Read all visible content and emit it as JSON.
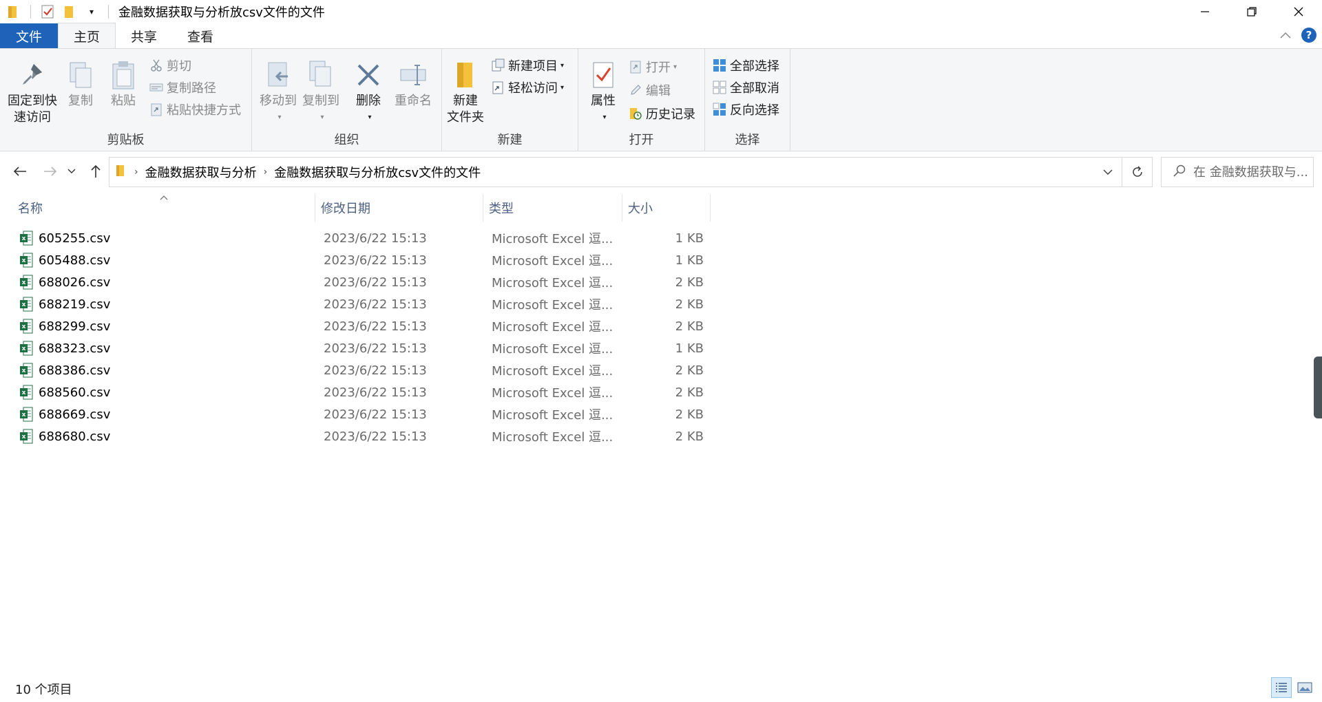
{
  "window": {
    "title": "金融数据获取与分析放csv文件的文件",
    "controls": {
      "minimize": "—",
      "restore": "❐",
      "close": "✕"
    }
  },
  "ribbon": {
    "tabs": {
      "file": "文件",
      "home": "主页",
      "share": "共享",
      "view": "查看"
    },
    "clipboard": {
      "label": "剪贴板",
      "pin": [
        "固定到快",
        "速访问"
      ],
      "copy": "复制",
      "paste": "粘贴",
      "cut": "剪切",
      "copy_path": "复制路径",
      "paste_shortcut": "粘贴快捷方式"
    },
    "organize": {
      "label": "组织",
      "move_to": "移动到",
      "copy_to": "复制到",
      "delete": "删除",
      "rename": "重命名"
    },
    "new": {
      "label": "新建",
      "new_folder": [
        "新建",
        "文件夹"
      ],
      "new_item": "新建项目",
      "easy_access": "轻松访问"
    },
    "open": {
      "label": "打开",
      "properties": "属性",
      "open": "打开",
      "edit": "编辑",
      "history": "历史记录"
    },
    "select": {
      "label": "选择",
      "select_all": "全部选择",
      "select_none": "全部取消",
      "invert": "反向选择"
    }
  },
  "address": {
    "crumbs": [
      "金融数据获取与分析",
      "金融数据获取与分析放csv文件的文件"
    ],
    "search_placeholder": "在 金融数据获取与..."
  },
  "columns": {
    "name": "名称",
    "date": "修改日期",
    "type": "类型",
    "size": "大小"
  },
  "files": [
    {
      "name": "605255.csv",
      "date": "2023/6/22 15:13",
      "type": "Microsoft Excel 逗...",
      "size": "1 KB"
    },
    {
      "name": "605488.csv",
      "date": "2023/6/22 15:13",
      "type": "Microsoft Excel 逗...",
      "size": "1 KB"
    },
    {
      "name": "688026.csv",
      "date": "2023/6/22 15:13",
      "type": "Microsoft Excel 逗...",
      "size": "2 KB"
    },
    {
      "name": "688219.csv",
      "date": "2023/6/22 15:13",
      "type": "Microsoft Excel 逗...",
      "size": "2 KB"
    },
    {
      "name": "688299.csv",
      "date": "2023/6/22 15:13",
      "type": "Microsoft Excel 逗...",
      "size": "2 KB"
    },
    {
      "name": "688323.csv",
      "date": "2023/6/22 15:13",
      "type": "Microsoft Excel 逗...",
      "size": "1 KB"
    },
    {
      "name": "688386.csv",
      "date": "2023/6/22 15:13",
      "type": "Microsoft Excel 逗...",
      "size": "2 KB"
    },
    {
      "name": "688560.csv",
      "date": "2023/6/22 15:13",
      "type": "Microsoft Excel 逗...",
      "size": "2 KB"
    },
    {
      "name": "688669.csv",
      "date": "2023/6/22 15:13",
      "type": "Microsoft Excel 逗...",
      "size": "2 KB"
    },
    {
      "name": "688680.csv",
      "date": "2023/6/22 15:13",
      "type": "Microsoft Excel 逗...",
      "size": "2 KB"
    }
  ],
  "status": {
    "item_count": "10 个项目"
  },
  "colors": {
    "accent": "#1e63b9",
    "excel_green": "#1d7044",
    "folder_yellow": "#f3c13a"
  }
}
